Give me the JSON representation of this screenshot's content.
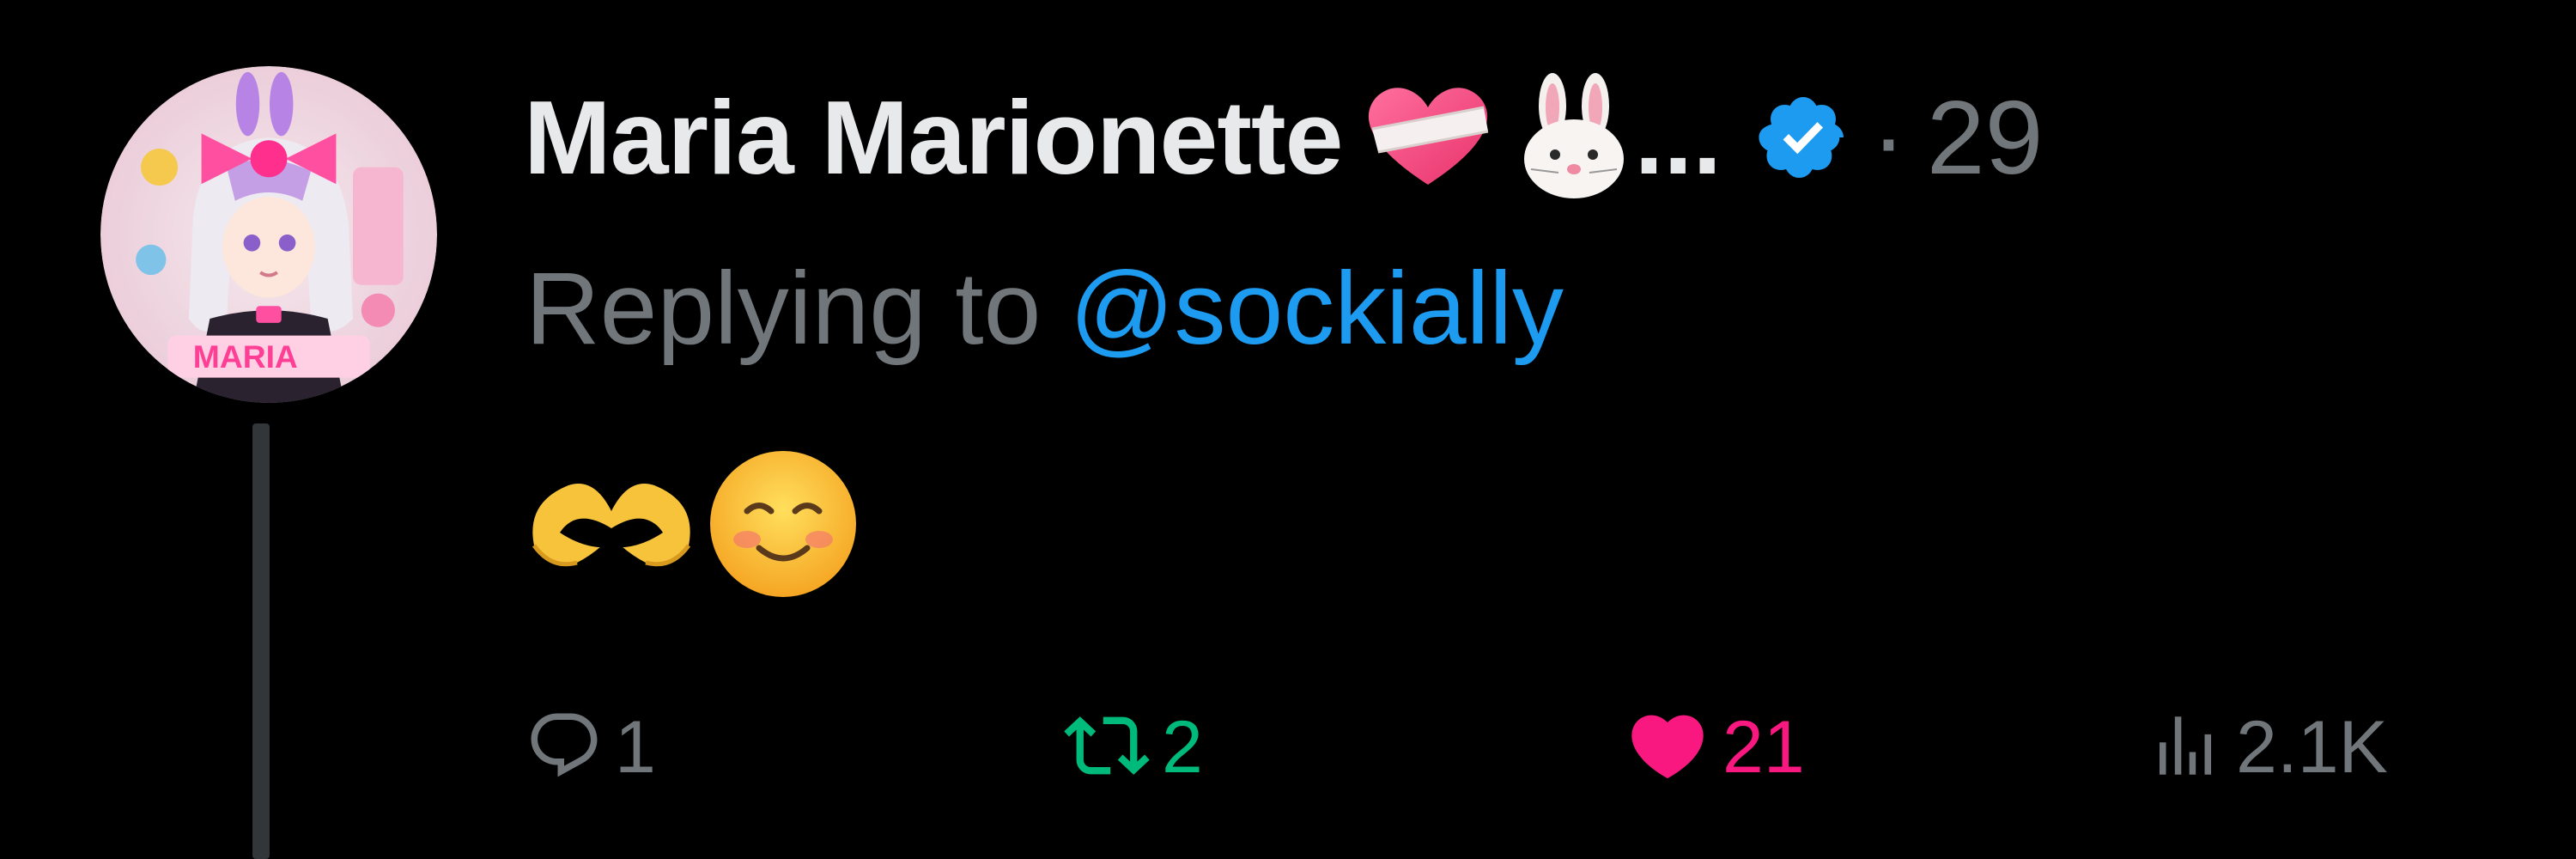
{
  "author": {
    "display_name": "Maria Marionette",
    "name_emoji": [
      "mending-heart-emoji",
      "rabbit-face-emoji"
    ],
    "truncation": "...",
    "verified": true,
    "separator": "·",
    "timestamp": "29"
  },
  "reply": {
    "prefix": "Replying to ",
    "handle": "@sockially"
  },
  "body": {
    "emoji": [
      "heart-hands-emoji",
      "smiling-face-emoji"
    ]
  },
  "actions": {
    "replies": "1",
    "retweets": "2",
    "likes": "21",
    "views": "2.1K"
  },
  "colors": {
    "background": "#000000",
    "text_primary": "#e7e9ea",
    "text_secondary": "#71767b",
    "link": "#1d9bf0",
    "retweet": "#00ba7c",
    "like": "#f91880",
    "verified": "#1d9bf0"
  }
}
